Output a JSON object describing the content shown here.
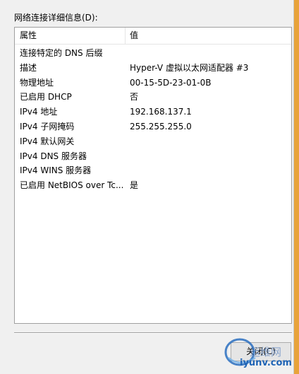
{
  "dialog": {
    "group_label": "网络连接详细信息(D):",
    "close_button_label": "关闭(C)"
  },
  "listview": {
    "columns": [
      "属性",
      "值"
    ],
    "rows": [
      {
        "property": "连接特定的 DNS 后缀",
        "value": ""
      },
      {
        "property": "描述",
        "value": "Hyper-V 虚拟以太网适配器 #3"
      },
      {
        "property": "物理地址",
        "value": "00-15-5D-23-01-0B"
      },
      {
        "property": "已启用 DHCP",
        "value": "否"
      },
      {
        "property": "IPv4 地址",
        "value": "192.168.137.1"
      },
      {
        "property": "IPv4 子网掩码",
        "value": "255.255.255.0"
      },
      {
        "property": "IPv4 默认网关",
        "value": ""
      },
      {
        "property": "IPv4 DNS 服务器",
        "value": ""
      },
      {
        "property": "IPv4 WINS 服务器",
        "value": ""
      },
      {
        "property": "已启用 NetBIOS over Tc...",
        "value": "是"
      }
    ]
  },
  "watermark": {
    "top_text": "运维网",
    "bottom_text": "iyunv.com"
  },
  "colors": {
    "window_border_accent": "#e8a33a",
    "background": "#f0f0f0",
    "list_background": "#ffffff"
  }
}
